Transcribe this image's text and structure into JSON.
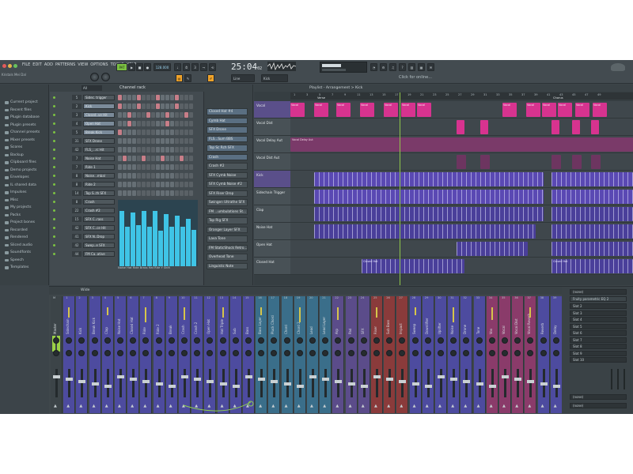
{
  "title_bar": {
    "menu": [
      "FILE",
      "EDIT",
      "ADD",
      "PATTERNS",
      "VIEW",
      "OPTIONS",
      "TOOLS",
      "HELP"
    ],
    "song_name": "Kristals Mei Dal",
    "tempo": "128.000",
    "time_main": "25:04",
    "time_sub": "02",
    "pattern_name": "Kick",
    "snap_mode": "Line",
    "hint_text": "Click for online..."
  },
  "colors": {
    "accent_green": "#7cc242",
    "accent_orange": "#f0a32a",
    "pattern_cyan": "#3fc4e6",
    "clip_pink": "#d7338f",
    "clip_purple": "#4a3f9a"
  },
  "browser": {
    "items": [
      "Current project",
      "Recent files",
      "Plugin database",
      "Plugin presets",
      "Channel presets",
      "Mixer presets",
      "Scores",
      "Backup",
      "Clipboard files",
      "Demo projects",
      "Envelopes",
      "IL shared data",
      "Impulses",
      "Misc",
      "My projects",
      "Packs",
      "Project bones",
      "Recorded",
      "Rendered",
      "Sliced audio",
      "Soundfonts",
      "Speech",
      "Templates"
    ]
  },
  "channel_rack": {
    "title": "Channel rack",
    "filter": "All",
    "channels": [
      {
        "num": "5",
        "name": "Sidec. trigger"
      },
      {
        "num": "2",
        "name": "Kick"
      },
      {
        "num": "3",
        "name": "Closed..ve Hit"
      },
      {
        "num": "4",
        "name": "Open Hat"
      },
      {
        "num": "5",
        "name": "Break Kick"
      },
      {
        "num": "31",
        "name": "SFX Drone"
      },
      {
        "num": "42",
        "name": "FLS_...rc Hit"
      },
      {
        "num": "7",
        "name": "Noise Hat"
      },
      {
        "num": "7",
        "name": "Ride 1"
      },
      {
        "num": "8",
        "name": "Noise...mbal"
      },
      {
        "num": "8",
        "name": "Ride 2"
      },
      {
        "num": "14",
        "name": "Top S..th SFX"
      },
      {
        "num": "8",
        "name": "Crash"
      },
      {
        "num": "22",
        "name": "Crash #2"
      },
      {
        "num": "15",
        "name": "SFX C..rass"
      },
      {
        "num": "42",
        "name": "SFX C..ce Hit"
      },
      {
        "num": "41",
        "name": "SFX N..Drop"
      },
      {
        "num": "42",
        "name": "Swep..e SFX"
      },
      {
        "num": "44",
        "name": "FM Ca..ative"
      }
    ],
    "piano_labels": "Noise Hat Ride Brass Hat Rite Y Shift"
  },
  "pattern_list": {
    "items": [
      "Closed Hat #4",
      "Cymb Hat",
      "SFX Drone",
      "FLS...Sum BBS",
      "Top Sc Rch SFX",
      "Crash",
      "Crash #2",
      "SFX Cymb Noise",
      "SFX Cymb Noise #2",
      "SFX Riser Drop",
      "Swingen Ultrathe SFX",
      "FM ...umbulations St...",
      "Top Rig SFX",
      "Oranger Layer SFX",
      "Lava Tone",
      "FM StaticShock Retro...",
      "Overhead Tone",
      "Linguistic Note"
    ]
  },
  "playlist": {
    "title": "Playlist - Arrangement > Kick",
    "markers": [
      "Verse",
      "Chorus"
    ],
    "bars": [
      "1",
      "3",
      "5",
      "7",
      "9",
      "11",
      "13",
      "15",
      "17",
      "19",
      "21",
      "23",
      "25",
      "27",
      "29",
      "31",
      "33",
      "35",
      "37",
      "39",
      "41",
      "43",
      "45",
      "47",
      "49"
    ],
    "tracks": [
      {
        "name": "Vocal",
        "color": "#d7338f"
      },
      {
        "name": "Vocal Dist",
        "color": "#d7338f"
      },
      {
        "name": "Vocal Delay Aut",
        "color": "#a3487f"
      },
      {
        "name": "Vocal Dist Aut",
        "color": "#8d3d6e"
      },
      {
        "name": "Kick",
        "color": "#5a49b3"
      },
      {
        "name": "Sidechain Trigger",
        "color": "#5a49b3"
      },
      {
        "name": "Clap",
        "color": "#4a3f9a"
      },
      {
        "name": "Noise Hat",
        "color": "#4a3f9a"
      },
      {
        "name": "Open Hat",
        "color": "#4a3f9a"
      },
      {
        "name": "Closed Hat",
        "color": "#4a3f9a"
      }
    ],
    "clip_labels": {
      "vocal": "Vocal",
      "delay": "Vocal Delay Aut",
      "closed_hat": "Closed Hat"
    }
  },
  "mixer": {
    "title": "Wide",
    "strips": [
      {
        "num": "M",
        "name": "Master",
        "color": "#3c4448"
      },
      {
        "num": "1",
        "name": "Sidechain",
        "color": "#4d4b9f"
      },
      {
        "num": "2",
        "name": "Kick",
        "color": "#4d4b9f"
      },
      {
        "num": "3",
        "name": "Break Kick",
        "color": "#4d4b9f"
      },
      {
        "num": "4",
        "name": "Clap",
        "color": "#4d4b9f"
      },
      {
        "num": "5",
        "name": "Noise Hat",
        "color": "#4d4b9f"
      },
      {
        "num": "6",
        "name": "Closed Hat",
        "color": "#4d4b9f"
      },
      {
        "num": "7",
        "name": "Ride",
        "color": "#4d4b9f"
      },
      {
        "num": "8",
        "name": "Ride 2",
        "color": "#4d4b9f"
      },
      {
        "num": "9",
        "name": "Break",
        "color": "#4d4b9f"
      },
      {
        "num": "10",
        "name": "Crash",
        "color": "#4d4b9f"
      },
      {
        "num": "11",
        "name": "Crash 2",
        "color": "#4d4b9f"
      },
      {
        "num": "12",
        "name": "Open Hat",
        "color": "#4d4b9f"
      },
      {
        "num": "13",
        "name": "Hat Triple",
        "color": "#4d4b9f"
      },
      {
        "num": "14",
        "name": "Sub",
        "color": "#4d4b9f"
      },
      {
        "num": "15",
        "name": "Bass",
        "color": "#4d4b9f"
      },
      {
        "num": "16",
        "name": "Bass Layer",
        "color": "#3a6e8a"
      },
      {
        "num": "17",
        "name": "Pluck Chord",
        "color": "#3a6e8a"
      },
      {
        "num": "18",
        "name": "Chord",
        "color": "#3a6e8a"
      },
      {
        "num": "19",
        "name": "Chord 2",
        "color": "#3a6e8a"
      },
      {
        "num": "20",
        "name": "Lead",
        "color": "#3a6e8a"
      },
      {
        "num": "21",
        "name": "Lead Layer",
        "color": "#3a6e8a"
      },
      {
        "num": "22",
        "name": "Arp",
        "color": "#5b4c8a"
      },
      {
        "num": "23",
        "name": "Pad",
        "color": "#5b4c8a"
      },
      {
        "num": "24",
        "name": "SFX",
        "color": "#5b4c8a"
      },
      {
        "num": "25",
        "name": "Riser",
        "color": "#8a3b3b"
      },
      {
        "num": "26",
        "name": "Sub Bass",
        "color": "#8a3b3b"
      },
      {
        "num": "27",
        "name": "Impact",
        "color": "#8a3b3b"
      },
      {
        "num": "28",
        "name": "Sweep",
        "color": "#4d4b9f"
      },
      {
        "num": "29",
        "name": "Downlifter",
        "color": "#4d4b9f"
      },
      {
        "num": "30",
        "name": "Uplifter",
        "color": "#4d4b9f"
      },
      {
        "num": "31",
        "name": "Noise",
        "color": "#4d4b9f"
      },
      {
        "num": "32",
        "name": "Drone",
        "color": "#4d4b9f"
      },
      {
        "num": "33",
        "name": "Tone",
        "color": "#4d4b9f"
      },
      {
        "num": "34",
        "name": "Vox",
        "color": "#8a3b6a"
      },
      {
        "num": "35",
        "name": "Vocal",
        "color": "#8a3b6a"
      },
      {
        "num": "36",
        "name": "Vocal Dist",
        "color": "#8a3b6a"
      },
      {
        "num": "37",
        "name": "Vocal Reverb",
        "color": "#8a3b6a"
      },
      {
        "num": "38",
        "name": "Reverb",
        "color": "#4d4b9f"
      },
      {
        "num": "39",
        "name": "Delay",
        "color": "#4d4b9f"
      }
    ],
    "panel": {
      "preset": "(none)",
      "slot_header": "Fruity parametric EQ 2",
      "slots": [
        "Slot 2",
        "Slot 3",
        "Slot 4",
        "Slot 5",
        "Slot 6",
        "Slot 7",
        "Slot 8",
        "Slot 9",
        "Slot 10"
      ],
      "out1": "(none)",
      "out2": "(none)"
    }
  }
}
